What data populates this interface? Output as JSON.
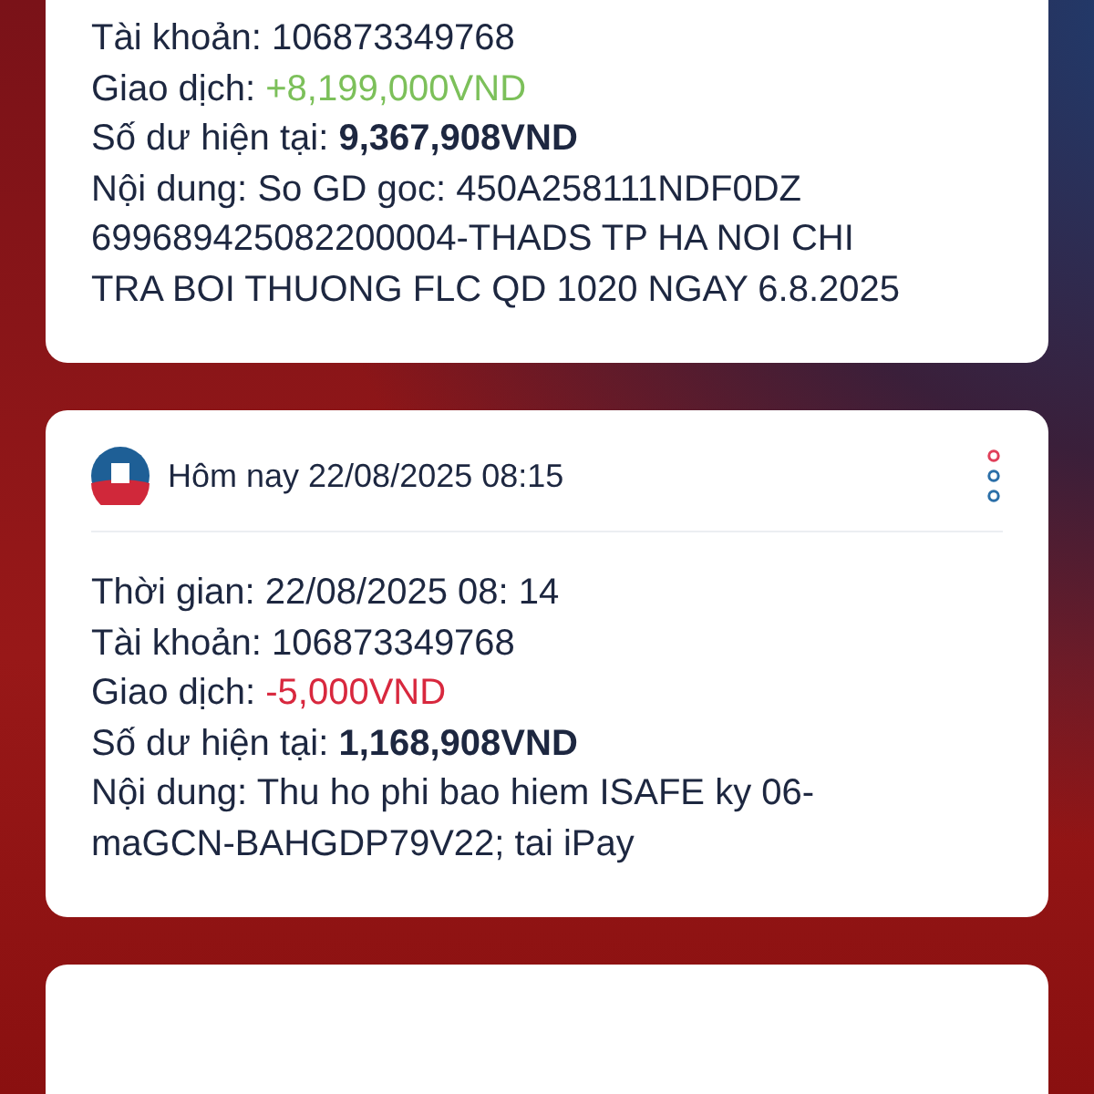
{
  "cards": [
    {
      "fields": [
        {
          "label": "Tài khoản:",
          "value": "106873349768",
          "kind": "plain"
        },
        {
          "label": "Giao dịch:",
          "value": "+8,199,000VND",
          "kind": "credit"
        },
        {
          "label": "Số dư hiện tại:",
          "value": "9,367,908VND",
          "kind": "bold"
        },
        {
          "label": "Nội dung:",
          "value": "So GD goc: 450A258111NDF0DZ 699689425082200004-THADS TP HA NOI CHI TRA BOI THUONG FLC QD 1020 NGAY 6.8.2025",
          "kind": "plain"
        }
      ]
    },
    {
      "header": {
        "title": "Hôm nay 22/08/2025 08:15"
      },
      "fields": [
        {
          "label": "Thời gian:",
          "value": "22/08/2025 08: 14",
          "kind": "plain"
        },
        {
          "label": "Tài khoản:",
          "value": "106873349768",
          "kind": "plain"
        },
        {
          "label": "Giao dịch:",
          "value": "-5,000VND",
          "kind": "debit"
        },
        {
          "label": "Số dư hiện tại:",
          "value": "1,168,908VND",
          "kind": "bold"
        },
        {
          "label": "Nội dung:",
          "value": "Thu ho phi bao hiem ISAFE ky 06-maGCN-BAHGDP79V22; tai iPay",
          "kind": "plain"
        }
      ]
    }
  ]
}
